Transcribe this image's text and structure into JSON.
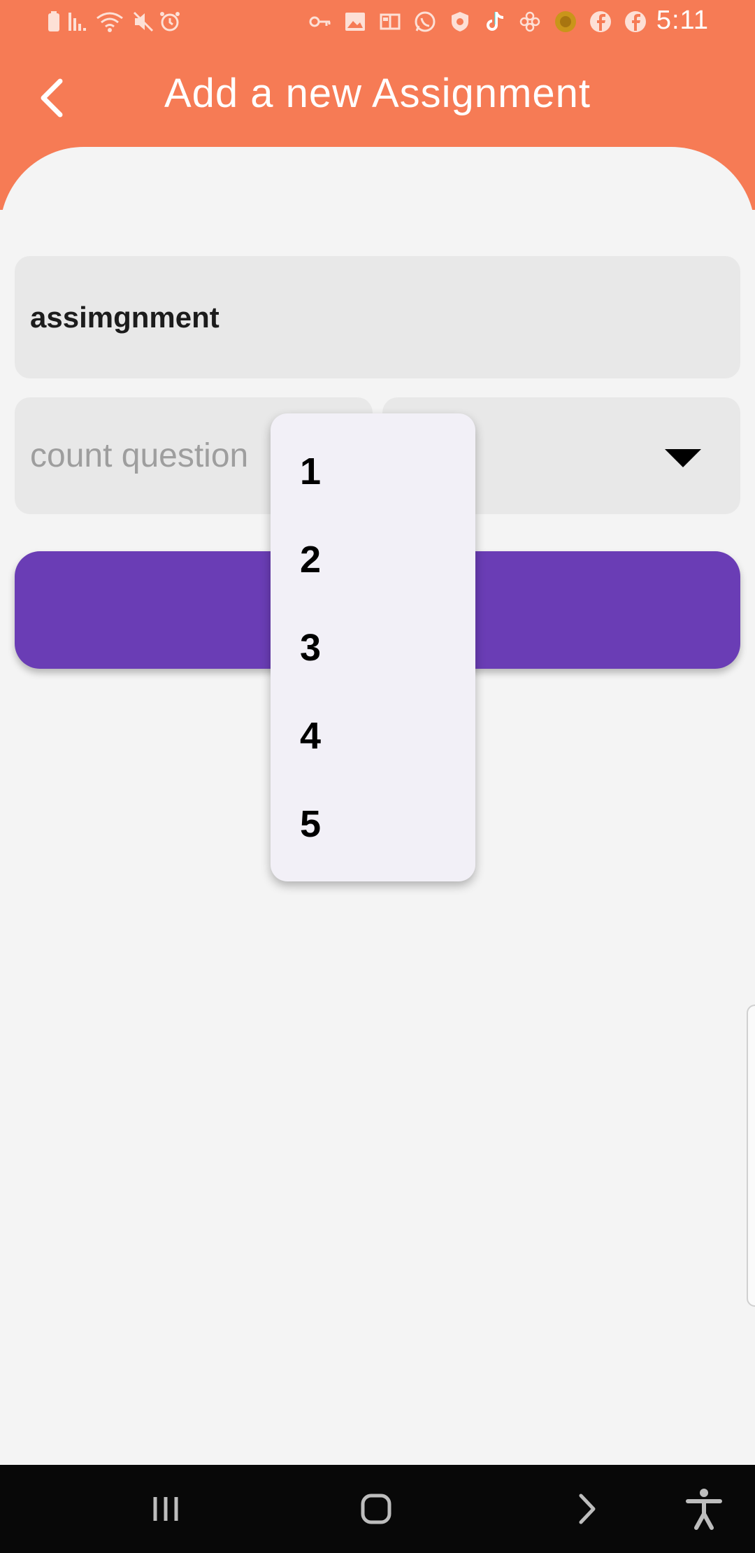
{
  "status_bar": {
    "time": "5:11",
    "left_icons": [
      "battery-icon",
      "signal-icon",
      "wifi-icon",
      "mute-icon",
      "alarm-icon"
    ],
    "right_icons": [
      "vpn-key-icon",
      "gallery-icon",
      "app-icon",
      "whatsapp-icon",
      "shield-icon",
      "tiktok-icon",
      "flower-icon",
      "coin-icon",
      "facebook-icon",
      "facebook-icon"
    ]
  },
  "header": {
    "title": "Add a new Assignment",
    "back_icon": "chevron-left-icon",
    "color": "#f67b55"
  },
  "form": {
    "name_value": "assimgnment",
    "count_placeholder": "count question",
    "select_arrow_icon": "triangle-down-icon",
    "submit_color": "#6a3db5"
  },
  "dropdown": {
    "options": [
      "1",
      "2",
      "3",
      "4",
      "5"
    ]
  },
  "nav_bar": {
    "icons": [
      "recent-apps-icon",
      "home-icon",
      "back-icon",
      "accessibility-icon"
    ]
  }
}
